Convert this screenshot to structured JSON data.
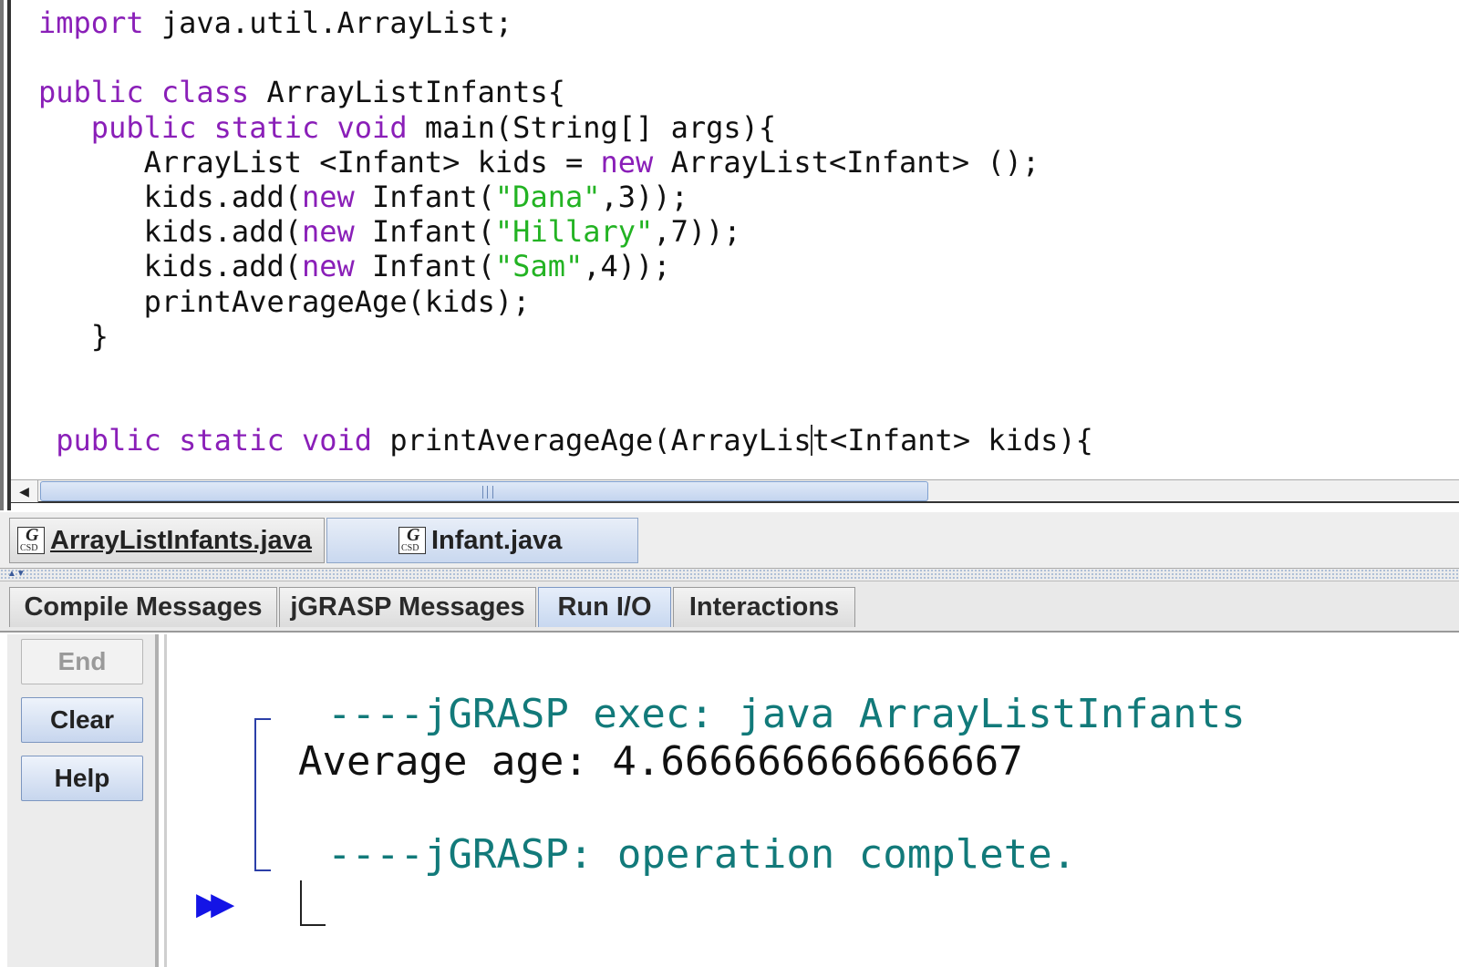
{
  "editor": {
    "lines": [
      [
        {
          "t": "import",
          "c": "kw"
        },
        {
          "t": " java.util.ArrayList;",
          "c": ""
        }
      ],
      [],
      [
        {
          "t": "public",
          "c": "kw"
        },
        {
          "t": " ",
          "c": ""
        },
        {
          "t": "class",
          "c": "kw"
        },
        {
          "t": " ArrayListInfants{",
          "c": ""
        }
      ],
      [
        {
          "t": "   ",
          "c": ""
        },
        {
          "t": "public",
          "c": "kw"
        },
        {
          "t": " ",
          "c": ""
        },
        {
          "t": "static",
          "c": "kw"
        },
        {
          "t": " ",
          "c": ""
        },
        {
          "t": "void",
          "c": "kw"
        },
        {
          "t": " main(String[] args){",
          "c": ""
        }
      ],
      [
        {
          "t": "      ArrayList <Infant> kids = ",
          "c": ""
        },
        {
          "t": "new",
          "c": "kw"
        },
        {
          "t": " ArrayList<Infant> ();",
          "c": ""
        }
      ],
      [
        {
          "t": "      kids.add(",
          "c": ""
        },
        {
          "t": "new",
          "c": "kw"
        },
        {
          "t": " Infant(",
          "c": ""
        },
        {
          "t": "\"Dana\"",
          "c": "str"
        },
        {
          "t": ",3));",
          "c": ""
        }
      ],
      [
        {
          "t": "      kids.add(",
          "c": ""
        },
        {
          "t": "new",
          "c": "kw"
        },
        {
          "t": " Infant(",
          "c": ""
        },
        {
          "t": "\"Hillary\"",
          "c": "str"
        },
        {
          "t": ",7));",
          "c": ""
        }
      ],
      [
        {
          "t": "      kids.add(",
          "c": ""
        },
        {
          "t": "new",
          "c": "kw"
        },
        {
          "t": " Infant(",
          "c": ""
        },
        {
          "t": "\"Sam\"",
          "c": "str"
        },
        {
          "t": ",4));",
          "c": ""
        }
      ],
      [
        {
          "t": "      printAverageAge(kids);",
          "c": ""
        }
      ],
      [
        {
          "t": "   }",
          "c": ""
        }
      ],
      [],
      [],
      [
        {
          "t": " ",
          "c": ""
        },
        {
          "t": "public",
          "c": "kw"
        },
        {
          "t": " ",
          "c": ""
        },
        {
          "t": "static",
          "c": "kw"
        },
        {
          "t": " ",
          "c": ""
        },
        {
          "t": "void",
          "c": "kw"
        },
        {
          "t": " printAverageAge(ArrayLis",
          "c": ""
        },
        {
          "t": "|caret|",
          "c": "caret"
        },
        {
          "t": "t<Infant> kids){",
          "c": ""
        }
      ]
    ]
  },
  "file_tabs": [
    {
      "label": "ArrayListInfants.java",
      "active": true
    },
    {
      "label": "Infant.java",
      "active": false
    }
  ],
  "csd_icon": {
    "letter": "G",
    "sub": "CSD"
  },
  "message_tabs": [
    {
      "label": "Compile Messages",
      "active": false
    },
    {
      "label": "jGRASP Messages",
      "active": false
    },
    {
      "label": "Run I/O",
      "active": true
    },
    {
      "label": "Interactions",
      "active": false
    }
  ],
  "side_buttons": {
    "end": "End",
    "clear": "Clear",
    "help": "Help"
  },
  "run_io": {
    "exec_line": "----jGRASP exec: java ArrayListInfants",
    "output_line": "Average age: 4.666666666666667",
    "complete_line": "----jGRASP: operation complete."
  },
  "colors": {
    "keyword": "#8a1fb8",
    "string": "#23b323",
    "io_teal": "#127a7a",
    "run_arrow": "#1414e6"
  }
}
